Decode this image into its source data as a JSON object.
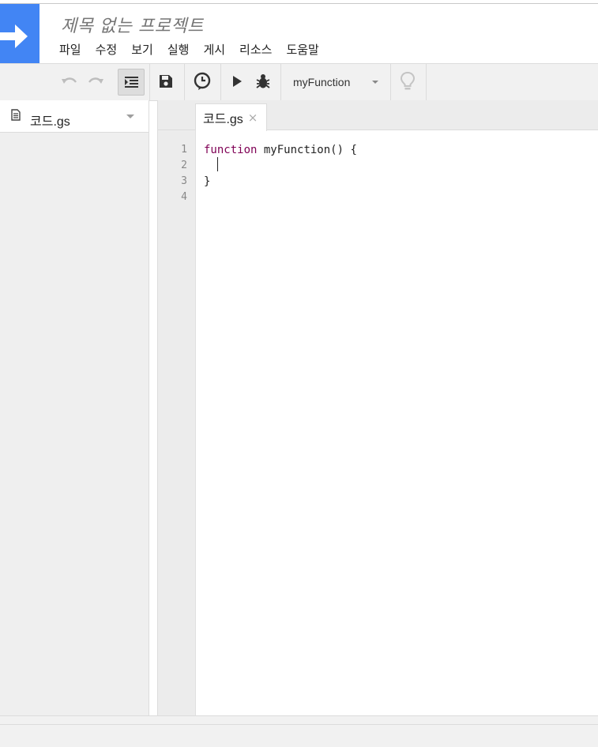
{
  "project": {
    "title": "제목 없는 프로젝트"
  },
  "menu": [
    "파일",
    "수정",
    "보기",
    "실행",
    "게시",
    "리소스",
    "도움말"
  ],
  "toolbar": {
    "function_select": "myFunction",
    "buttons": [
      "undo-icon",
      "redo-icon",
      "indent-icon",
      "save-icon",
      "triggers-clock-icon",
      "run-icon",
      "debug-bug-icon",
      "lightbulb-icon"
    ]
  },
  "sidebar": {
    "files": [
      {
        "name": "코드.gs",
        "icon": "document-icon"
      }
    ]
  },
  "editor": {
    "tab_label": "코드.gs",
    "tab_close": "×",
    "line_numbers": [
      "1",
      "2",
      "3",
      "4"
    ],
    "code": {
      "line1_keyword": "function",
      "line1_rest": " myFunction() {",
      "line2": "  ",
      "line3": "}",
      "line4": ""
    }
  },
  "colors": {
    "brand": "#4285f4",
    "keyword": "#7f0055"
  }
}
